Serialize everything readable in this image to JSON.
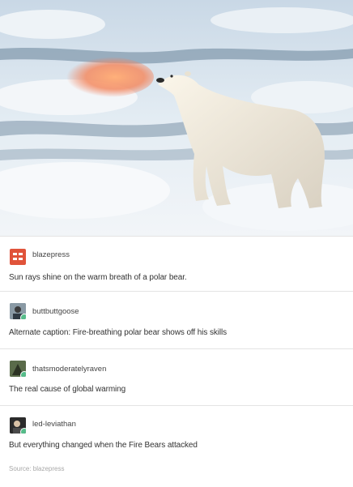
{
  "posts": [
    {
      "username": "blazepress",
      "text": "Sun rays shine on the warm breath of a polar bear."
    },
    {
      "username": "buttbuttgoose",
      "text": "Alternate caption: Fire-breathing polar bear shows off his skills"
    },
    {
      "username": "thatsmoderatelyraven",
      "text": "The real cause of global warming"
    },
    {
      "username": "led-leviathan",
      "text": "But everything changed when the Fire Bears attacked"
    }
  ],
  "source": "Source:  blazepress",
  "colors": {
    "badge": "#56bc8a",
    "blazepress_avatar": "#e0533a"
  }
}
